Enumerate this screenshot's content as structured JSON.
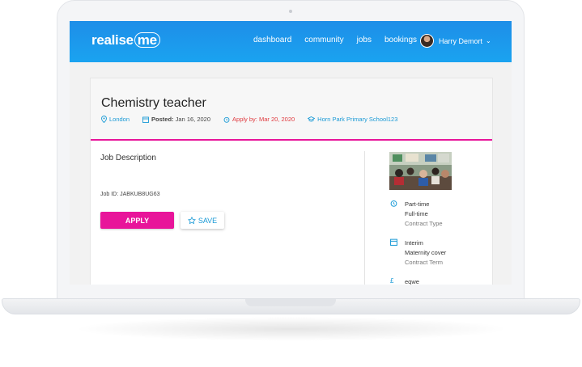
{
  "nav": {
    "logo_text": "realise",
    "logo_badge": "me",
    "links": [
      "dashboard",
      "community",
      "jobs",
      "bookings"
    ],
    "user_name": "Harry Demort"
  },
  "job": {
    "title": "Chemistry teacher",
    "location": "London",
    "posted_label": "Posted:",
    "posted_date": "Jan 16, 2020",
    "apply_by_label": "Apply by:",
    "apply_by_date": "Mar 20, 2020",
    "school": "Horn Park Primary School123",
    "description_heading": "Job Description",
    "job_id": "Job ID: JABKUB8UG63",
    "apply_label": "APPLY",
    "save_label": "SAVE"
  },
  "sidebar": {
    "contract_type": [
      "Part-time",
      "Full-time"
    ],
    "contract_type_label": "Contract Type",
    "contract_term": [
      "Interim",
      "Maternity cover"
    ],
    "contract_term_label": "Contract Term",
    "salary": "eqwe"
  },
  "colors": {
    "accent": "#e8159a",
    "brand": "#1a9ad6",
    "nav": "#1e8ee8",
    "alert": "#e0393e"
  }
}
